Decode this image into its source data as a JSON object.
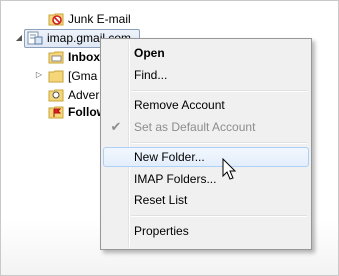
{
  "tree": {
    "junk": "Junk E-mail",
    "account": "imap.gmail.com",
    "inbox": "Inbox",
    "gmail": "[Gma",
    "adver": "Adver",
    "follow": "Follow"
  },
  "menu": {
    "open": "Open",
    "find": "Find...",
    "remove_account": "Remove Account",
    "set_default": "Set as Default Account",
    "new_folder": "New Folder...",
    "imap_folders": "IMAP Folders...",
    "reset_list": "Reset List",
    "properties": "Properties"
  },
  "icons": {
    "check": "check-icon",
    "expander_open": "expand-open-icon",
    "expander_closed": "expand-closed-icon"
  },
  "colors": {
    "hover_border": "#aecff7",
    "selection_border": "#8aa0bd"
  }
}
